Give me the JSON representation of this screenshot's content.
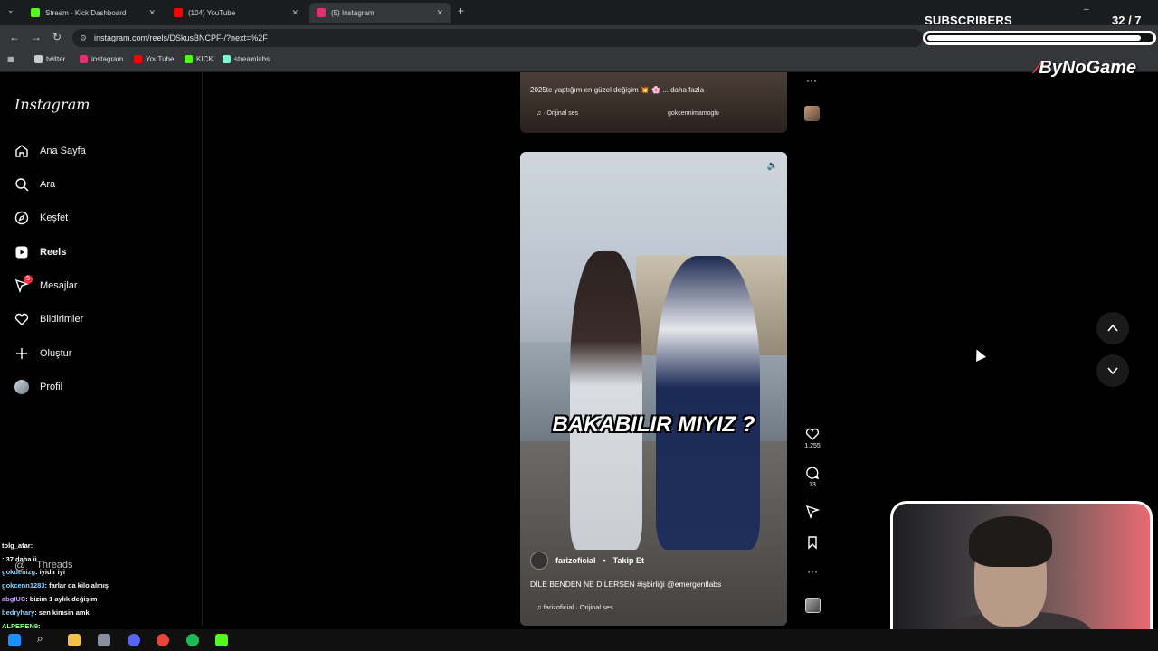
{
  "browser": {
    "tabs": [
      {
        "label": "Stream - Kick Dashboard",
        "color": "#53fc18"
      },
      {
        "label": "(104) YouTube",
        "color": "#ff0000"
      },
      {
        "label": "(5) Instagram",
        "color": "#e1306c"
      }
    ],
    "url": "instagram.com/reels/DSkusBNCPF-/?next=%2F",
    "bookmarks": [
      {
        "label": "twitter",
        "color": "#cccccc"
      },
      {
        "label": "instagram",
        "color": "#e1306c"
      },
      {
        "label": "YouTube",
        "color": "#ff0000"
      },
      {
        "label": "KICK",
        "color": "#53fc18"
      },
      {
        "label": "streamlabs",
        "color": "#80f5d2"
      }
    ]
  },
  "sidebar": {
    "logo": "Instagram",
    "items": [
      {
        "label": "Ana Sayfa",
        "icon": "home-icon"
      },
      {
        "label": "Ara",
        "icon": "search-icon"
      },
      {
        "label": "Keşfet",
        "icon": "compass-icon"
      },
      {
        "label": "Reels",
        "icon": "reels-icon"
      },
      {
        "label": "Mesajlar",
        "icon": "messenger-icon",
        "badge": "5"
      },
      {
        "label": "Bildirimler",
        "icon": "heart-icon"
      },
      {
        "label": "Oluştur",
        "icon": "plus-icon"
      },
      {
        "label": "Profil",
        "icon": "avatar-icon"
      }
    ],
    "threads": "Threads"
  },
  "prev_reel": {
    "caption": "2025te yaptığım en güzel değişim 💥 🌸 ... daha fazla",
    "audio": "· Orijinal ses",
    "user": "gokcennimamoglu"
  },
  "reel": {
    "overlay_text": "BAKABILIR MIYIZ ?",
    "username": "farizoficial",
    "follow": "Takip Et",
    "caption": "DİLE BENDEN NE DİLERSEN #işbirliği @emergentlabs",
    "audio": "farizoficial · Orijinal ses",
    "likes": "1.255",
    "comments": "13"
  },
  "overlay": {
    "subscribers_label": "SUBSCRIBERS",
    "subscribers_count": "32  / 7",
    "subscribers_progress": 0.95,
    "brand": "ByNoGame"
  },
  "chat": [
    {
      "user": "tolg_atar",
      "msg": ":",
      "color": "#ffffff"
    },
    {
      "user": "",
      "msg": ": 37 daha ii",
      "color": "#9bff9b"
    },
    {
      "user": "gokdenizg",
      "msg": ": iyidir iyi",
      "color": "#8fd3ff"
    },
    {
      "user": "gokcenn1283",
      "msg": ": farlar da kilo almış",
      "color": "#8fd3ff"
    },
    {
      "user": "abgIUC",
      "msg": ": bizim 1 aylık değişim",
      "color": "#c9a0ff"
    },
    {
      "user": "bedryhary",
      "msg": ": sen kimsin amk",
      "color": "#8fd3ff"
    },
    {
      "user": "ALPEREN9",
      "msg": ":",
      "color": "#9bff9b"
    }
  ]
}
